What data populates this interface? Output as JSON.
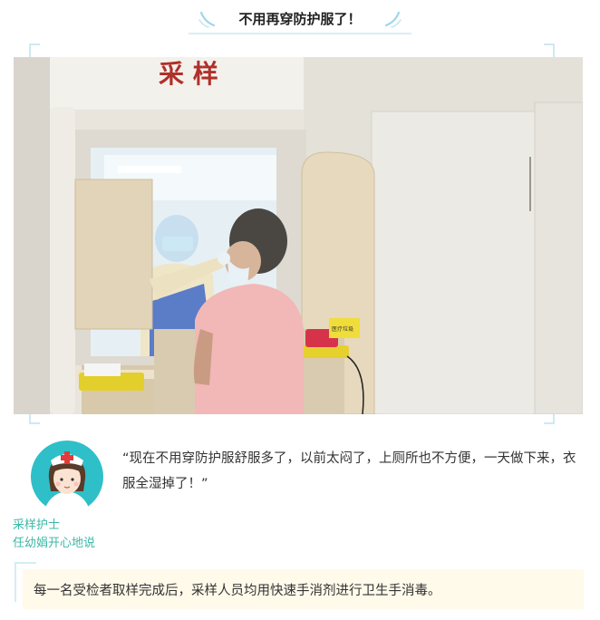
{
  "header": {
    "title": "不用再穿防护服了！"
  },
  "photo": {
    "sign_text": "采 样",
    "bin_label": "医疗垃圾"
  },
  "quote": {
    "speaker_role": "采样护士",
    "speaker_name": "任幼娟开心地说",
    "text": "“现在不用穿防护服舒服多了，以前太闷了，上厕所也不方便，一天做下来，衣服全湿掉了！”"
  },
  "note": {
    "text": "每一名受检者取样完成后，采样人员均用快速手消剂进行卫生手消毒。"
  },
  "colors": {
    "accent_teal": "#3bb8a6",
    "frame_blue": "#cfe9f2",
    "note_bg": "#fffaea"
  }
}
